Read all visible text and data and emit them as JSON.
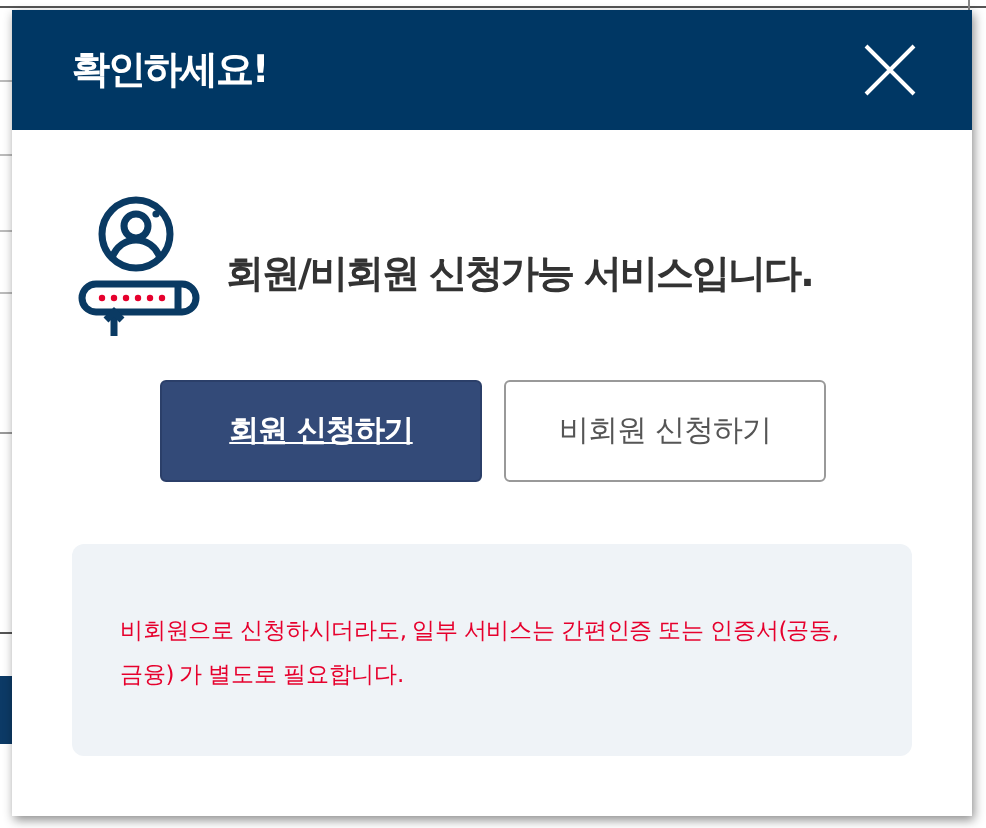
{
  "dialog": {
    "title": "확인하세요!",
    "message": "회원/비회원 신청가능 서비스입니다.",
    "buttons": [
      {
        "label": "회원 신청하기",
        "kind": "primary"
      },
      {
        "label": "비회원 신청하기",
        "kind": "secondary"
      }
    ],
    "notice": "비회원으로 신청하시더라도, 일부 서비스는 간편인증 또는 인증서(공동, 금융) 가 별도로 필요합니다."
  }
}
